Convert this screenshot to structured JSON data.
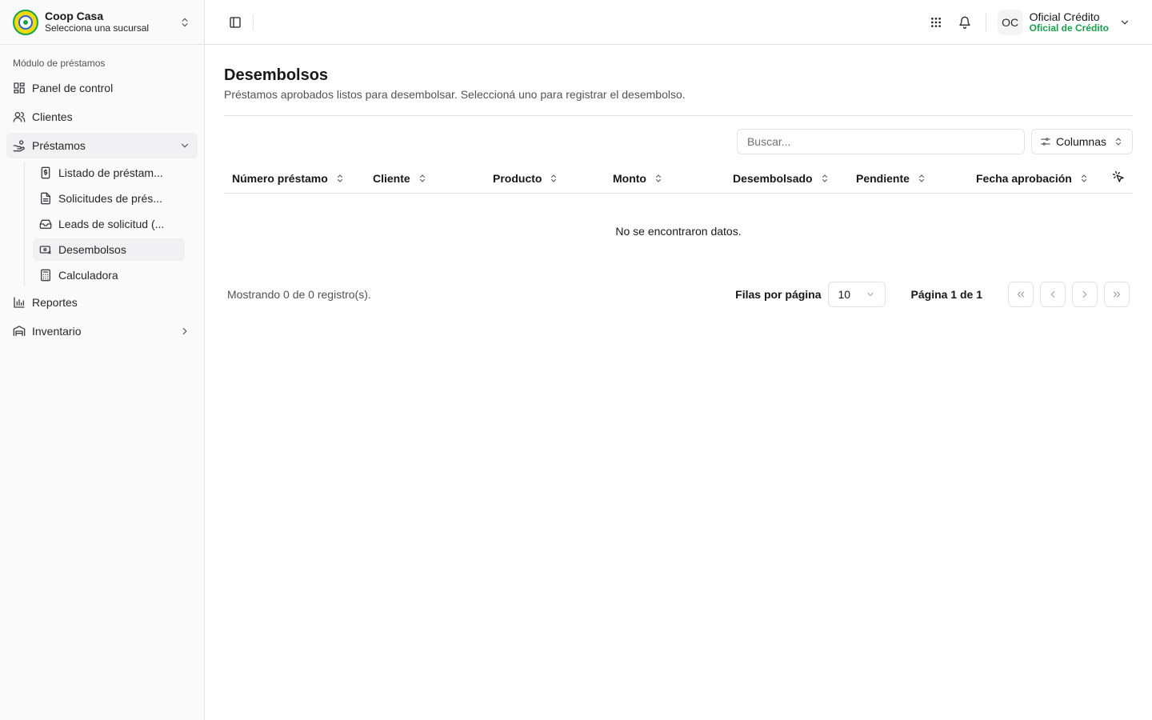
{
  "org": {
    "name": "Coop Casa",
    "branch_prompt": "Selecciona una sucursal"
  },
  "sidebar": {
    "group_label": "Módulo de préstamos",
    "items": [
      {
        "label": "Panel de control",
        "icon": "dashboard-grid-icon"
      },
      {
        "label": "Clientes",
        "icon": "users-icon"
      },
      {
        "label": "Préstamos",
        "icon": "hand-coins-icon",
        "expanded": true
      },
      {
        "label": "Reportes",
        "icon": "bar-chart-icon"
      },
      {
        "label": "Inventario",
        "icon": "warehouse-icon"
      }
    ],
    "loan_subitems": [
      {
        "label": "Listado de préstam...",
        "icon": "receipt-dollar-icon"
      },
      {
        "label": "Solicitudes de prés...",
        "icon": "document-icon"
      },
      {
        "label": "Leads de solicitud (...",
        "icon": "inbox-icon"
      },
      {
        "label": "Desembolsos",
        "icon": "banknote-icon",
        "active": true
      },
      {
        "label": "Calculadora",
        "icon": "calculator-icon"
      }
    ]
  },
  "topbar": {
    "user_initials": "OC",
    "user_name": "Oficial Crédito",
    "user_role": "Oficial de Crédito"
  },
  "page": {
    "title": "Desembolsos",
    "description": "Préstamos aprobados listos para desembolsar. Seleccioná uno para registrar el desembolso."
  },
  "toolbar": {
    "search_placeholder": "Buscar...",
    "columns_label": "Columnas"
  },
  "table": {
    "columns": [
      "Número préstamo",
      "Cliente",
      "Producto",
      "Monto",
      "Desembolsado",
      "Pendiente",
      "Fecha aprobación"
    ],
    "empty_message": "No se encontraron datos."
  },
  "pagination": {
    "count_text": "Mostrando 0 de 0 registro(s).",
    "rows_per_page_label": "Filas por página",
    "rows_per_page": "10",
    "page_text": "Página 1 de 1"
  },
  "colors": {
    "accent_green": "#16a34a",
    "border": "#e4e4e7",
    "sidebar_bg": "#fafafa"
  }
}
